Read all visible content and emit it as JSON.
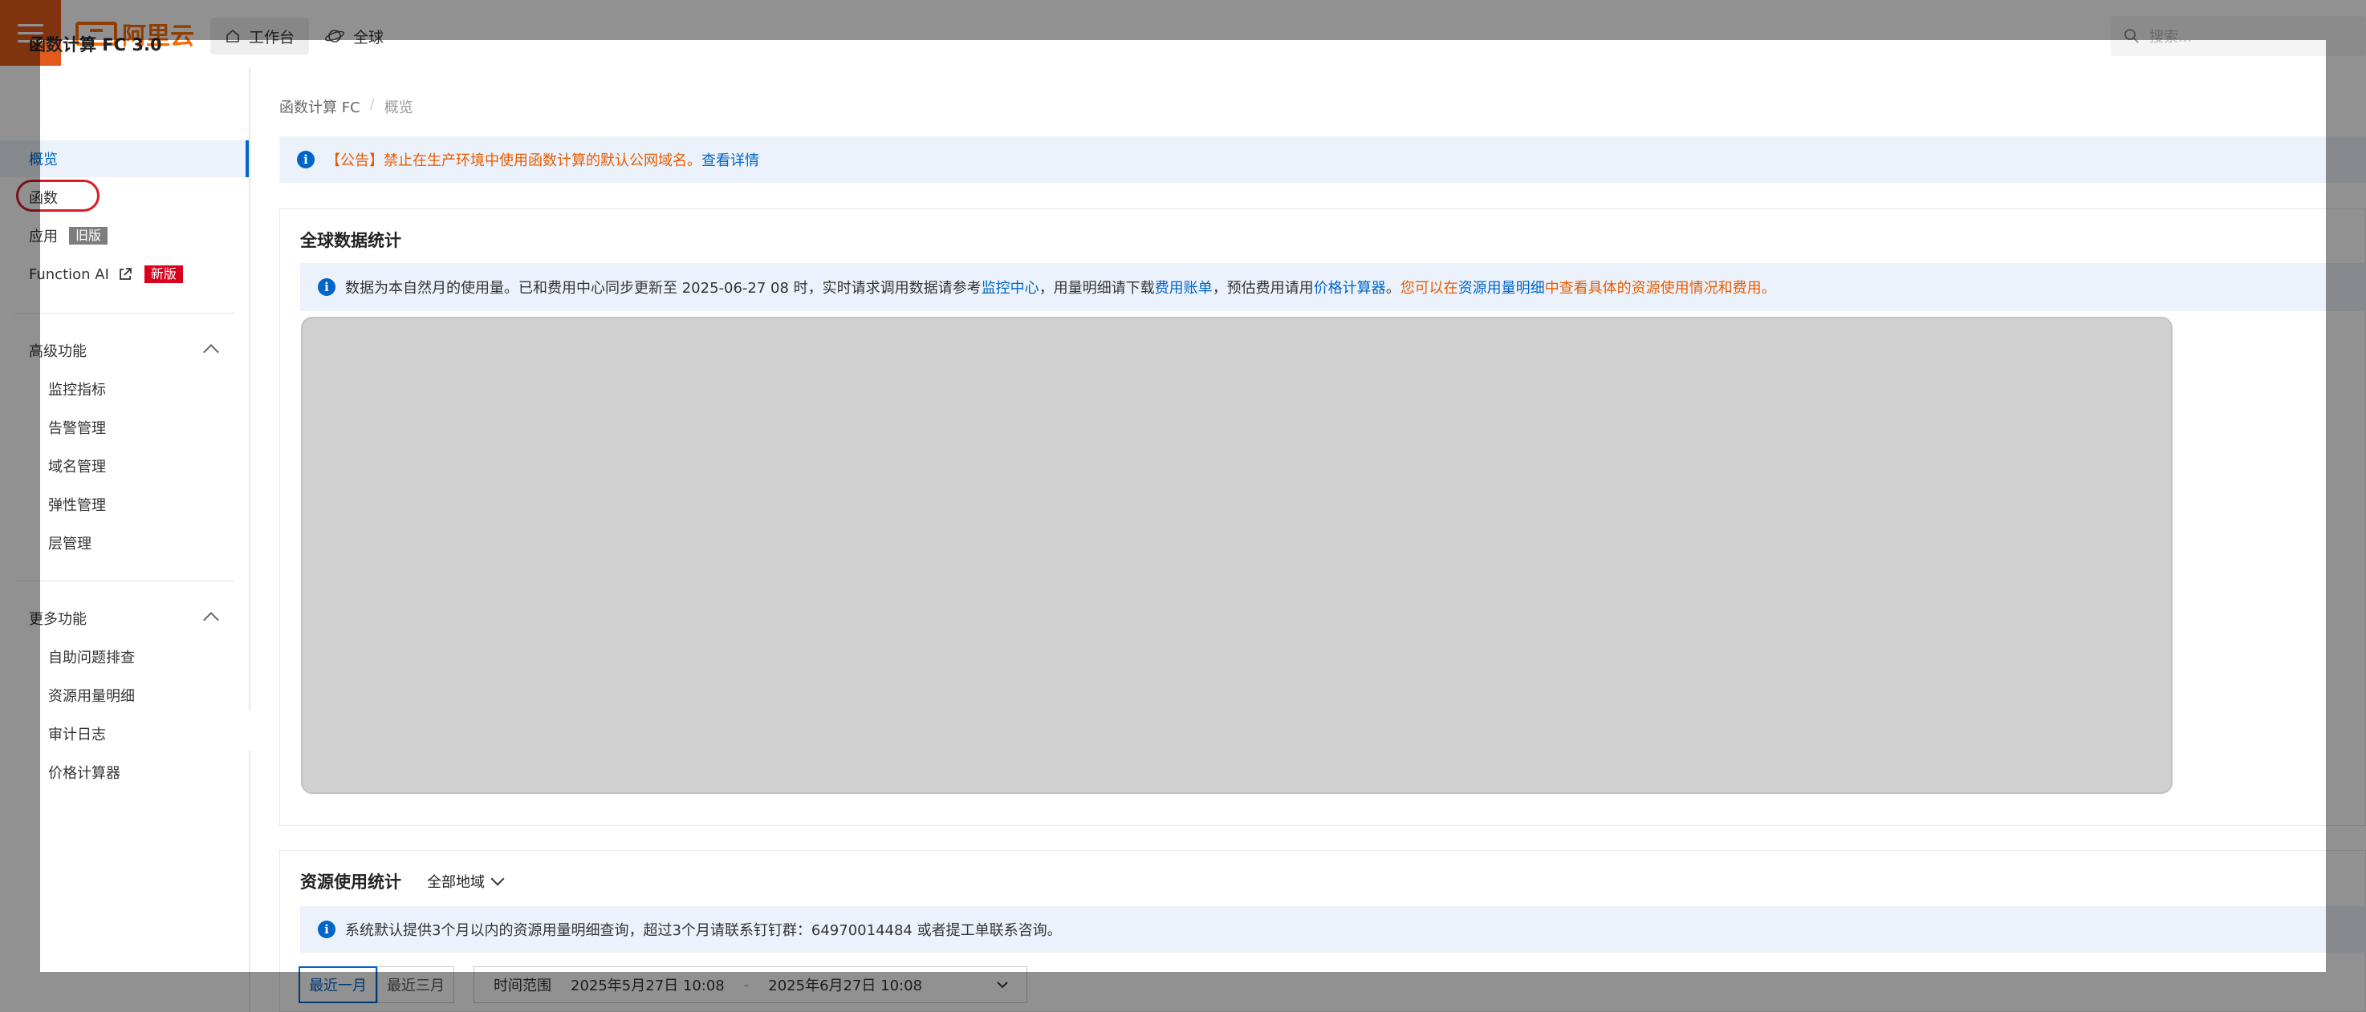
{
  "topbar": {
    "brand": "阿里云",
    "workbench": "工作台",
    "global": "全球",
    "search_placeholder": "搜索..."
  },
  "sidebar": {
    "title": "函数计算 FC 3.0",
    "items": [
      {
        "label": "概览"
      },
      {
        "label": "函数"
      },
      {
        "label": "应用",
        "badge": "旧版"
      },
      {
        "label": "Function AI",
        "badge": "新版"
      }
    ],
    "advanced": {
      "title": "高级功能",
      "items": [
        "监控指标",
        "告警管理",
        "域名管理",
        "弹性管理",
        "层管理"
      ]
    },
    "more": {
      "title": "更多功能",
      "items": [
        "自助问题排查",
        "资源用量明细",
        "审计日志",
        "价格计算器"
      ]
    }
  },
  "breadcrumb": {
    "root": "函数计算 FC",
    "sep": "/",
    "current": "概览"
  },
  "notice": {
    "text": "【公告】禁止在生产环境中使用函数计算的默认公网域名。",
    "link": "查看详情"
  },
  "global_stats": {
    "title": "全球数据统计",
    "info_1": "数据为本自然月的使用量。已和费用中心同步更新至 2025-06-27 08 时，实时请求调用数据请参考",
    "link_monitor": "监控中心",
    "info_2": "，用量明细请下载",
    "link_bill": "费用账单",
    "info_3": "，预估费用请用",
    "link_calc": "价格计算器",
    "info_4": "。",
    "orange_1": "您可以在",
    "link_usage": "资源用量明细",
    "orange_2": "中查看具体的资源使用情况和费用。"
  },
  "resource_stats": {
    "title": "资源使用统计",
    "region": "全部地域",
    "info": "系统默认提供3个月以内的资源用量明细查询，超过3个月请联系钉钉群：64970014484 或者提工单联系咨询。",
    "seg_month": "最近一月",
    "seg_three": "最近三月",
    "range_label": "时间范围",
    "range_start": "2025年5月27日 10:08",
    "range_sep": "-",
    "range_end": "2025年6月27日 10:08"
  },
  "colors": {
    "brand": "#ff6a00",
    "menu": "#e35a1b",
    "accent": "#0064c8",
    "warning": "#e65c00",
    "badge_new": "#d9001b"
  }
}
